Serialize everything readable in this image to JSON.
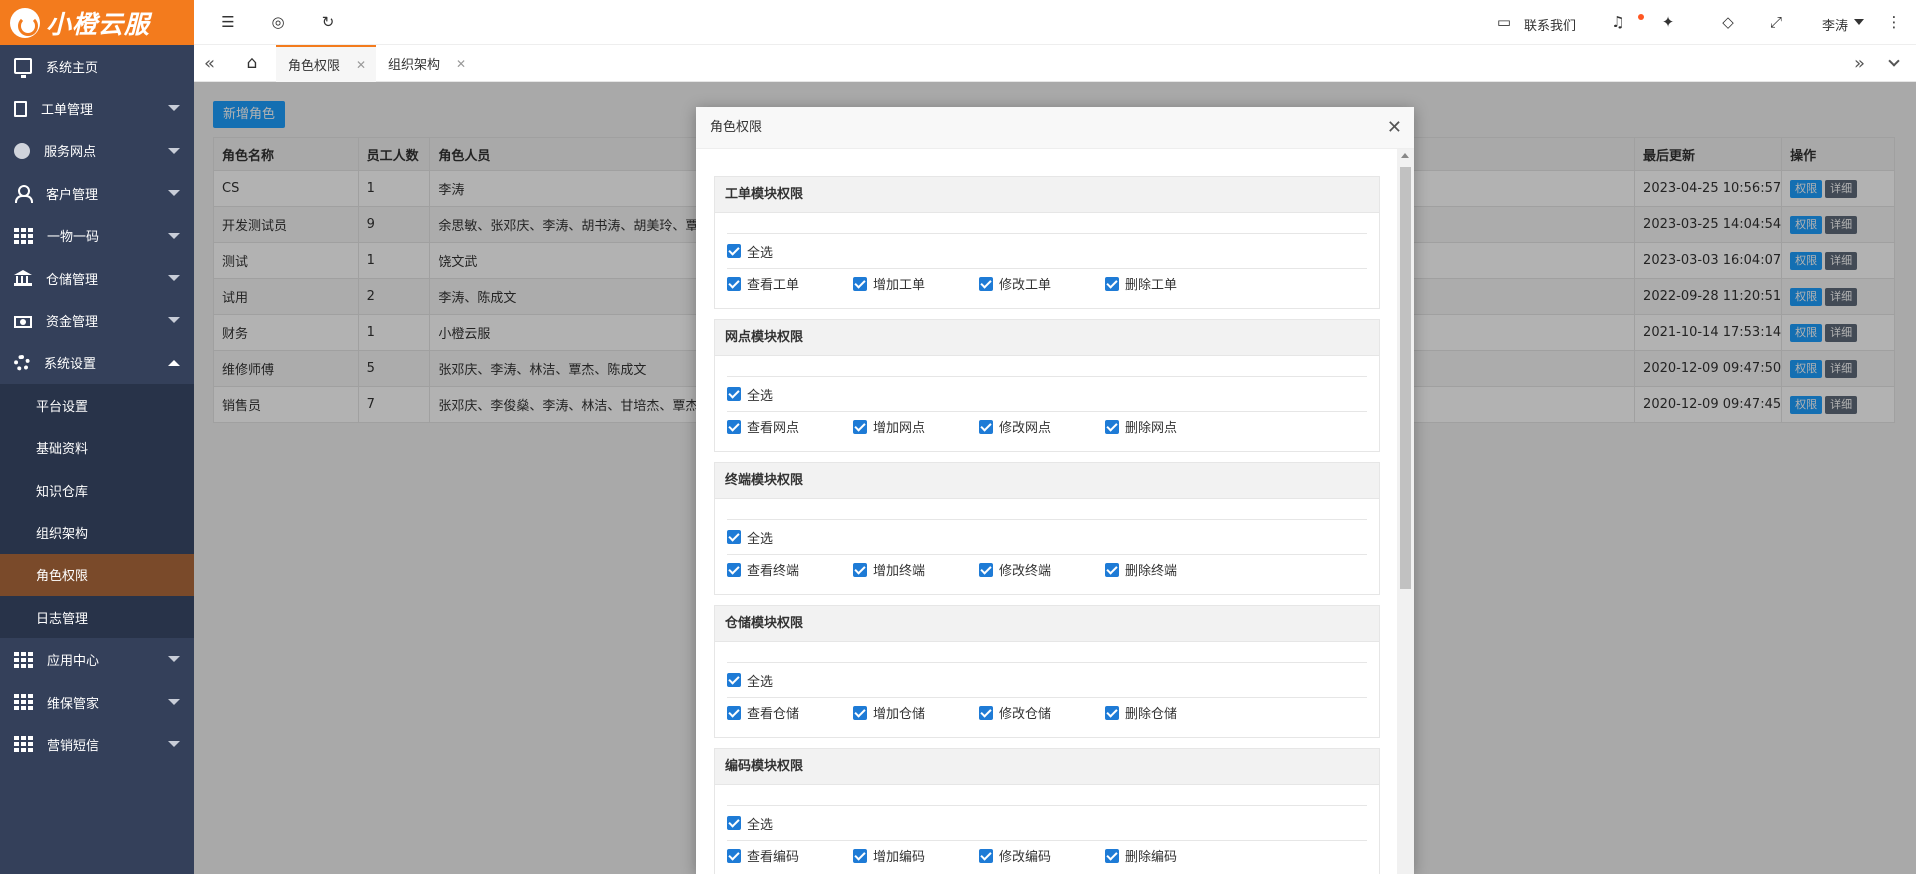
{
  "brand": {
    "name": "小橙云服"
  },
  "sidebar": {
    "items": [
      {
        "label": "系统主页",
        "icon": "monitor-icon"
      },
      {
        "label": "工单管理",
        "icon": "document-icon"
      },
      {
        "label": "服务网点",
        "icon": "globe-icon"
      },
      {
        "label": "客户管理",
        "icon": "user-icon"
      },
      {
        "label": "一物一码",
        "icon": "grid-icon"
      },
      {
        "label": "仓储管理",
        "icon": "bank-icon"
      },
      {
        "label": "资金管理",
        "icon": "money-icon"
      },
      {
        "label": "系统设置",
        "icon": "gear-icon"
      }
    ],
    "sub_items": [
      "平台设置",
      "基础资料",
      "知识仓库",
      "组织架构",
      "角色权限",
      "日志管理"
    ],
    "items_after": [
      {
        "label": "应用中心",
        "icon": "grid-icon"
      },
      {
        "label": "维保管家",
        "icon": "grid-icon"
      },
      {
        "label": "营销短信",
        "icon": "grid-icon"
      }
    ]
  },
  "topbar": {
    "contact": "联系我们",
    "user": "李涛"
  },
  "tabs": [
    {
      "label": "角色权限"
    },
    {
      "label": "组织架构"
    }
  ],
  "main": {
    "add_button": "新增角色",
    "columns": [
      "角色名称",
      "员工人数",
      "角色人员",
      "最后更新",
      "操作"
    ],
    "rows": [
      {
        "name": "CS",
        "count": "1",
        "members": "李涛",
        "updated": "2023-04-25 10:56:57"
      },
      {
        "name": "开发测试员",
        "count": "9",
        "members": "余思敏、张邓庆、李涛、胡书涛、胡美玲、覃杰",
        "updated": "2023-03-25 14:04:54"
      },
      {
        "name": "测试",
        "count": "1",
        "members": "饶文武",
        "updated": "2023-03-03 16:04:07"
      },
      {
        "name": "试用",
        "count": "2",
        "members": "李涛、陈成文",
        "updated": "2022-09-28 11:20:51"
      },
      {
        "name": "财务",
        "count": "1",
        "members": "小橙云服",
        "updated": "2021-10-14 17:53:14"
      },
      {
        "name": "维修师傅",
        "count": "5",
        "members": "张邓庆、李涛、林洁、覃杰、陈成文",
        "updated": "2020-12-09 09:47:50"
      },
      {
        "name": "销售员",
        "count": "7",
        "members": "张邓庆、李俊燊、李涛、林洁、甘培杰、覃杰、",
        "updated": "2020-12-09 09:47:45"
      }
    ],
    "action_perm": "权限",
    "action_detail": "详细"
  },
  "modal": {
    "title": "角色权限",
    "select_all": "全选",
    "panels": [
      {
        "title": "工单模块权限",
        "perms": [
          "查看工单",
          "增加工单",
          "修改工单",
          "删除工单"
        ]
      },
      {
        "title": "网点模块权限",
        "perms": [
          "查看网点",
          "增加网点",
          "修改网点",
          "删除网点"
        ]
      },
      {
        "title": "终端模块权限",
        "perms": [
          "查看终端",
          "增加终端",
          "修改终端",
          "删除终端"
        ]
      },
      {
        "title": "仓储模块权限",
        "perms": [
          "查看仓储",
          "增加仓储",
          "修改仓储",
          "删除仓储"
        ]
      },
      {
        "title": "编码模块权限",
        "perms": [
          "查看编码",
          "增加编码",
          "修改编码",
          "删除编码"
        ]
      }
    ]
  },
  "colors": {
    "brand": "#f37b1d",
    "sidebar": "#34405a",
    "primary": "#1e9fff",
    "active_sub": "#7a4a2a"
  }
}
